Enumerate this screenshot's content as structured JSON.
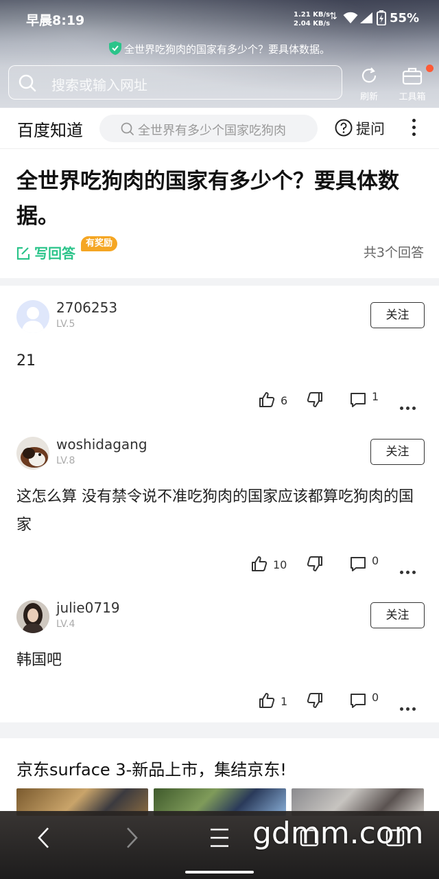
{
  "status_bar": {
    "time": "早晨8:19",
    "net_speed_up": "1.21 KB/s",
    "net_speed_down": "2.04 KB/s",
    "battery": "55%"
  },
  "browser": {
    "page_tip": "全世界吃狗肉的国家有多少个？要具体数据。",
    "search_placeholder": "搜索或输入网址",
    "refresh_label": "刷新",
    "toolbox_label": "工具箱"
  },
  "zhidao": {
    "logo": "百度知道",
    "search_placeholder": "全世界有多少个国家吃狗肉",
    "ask_label": "提问"
  },
  "question": {
    "title": "全世界吃狗肉的国家有多少个？要具体数据。",
    "write_answer": "写回答",
    "reward_badge": "有奖励",
    "answer_count": "共3个回答"
  },
  "answers": [
    {
      "username": "2706253",
      "level": "LV.5",
      "follow": "关注",
      "text": "21",
      "likes": "6",
      "comments": "1"
    },
    {
      "username": "woshidagang",
      "level": "LV.8",
      "follow": "关注",
      "text": "这怎么算 没有禁令说不准吃狗肉的国家应该都算吃狗肉的国家",
      "likes": "10",
      "comments": "0"
    },
    {
      "username": "julie0719",
      "level": "LV.4",
      "follow": "关注",
      "text": "韩国吧",
      "likes": "1",
      "comments": "0"
    }
  ],
  "ad": {
    "title": "京东surface 3-新品上市，集结京东!"
  },
  "watermark": "gdmm.com",
  "colors": {
    "accent_green": "#2bc48a",
    "reward_orange": "#f5a623"
  }
}
